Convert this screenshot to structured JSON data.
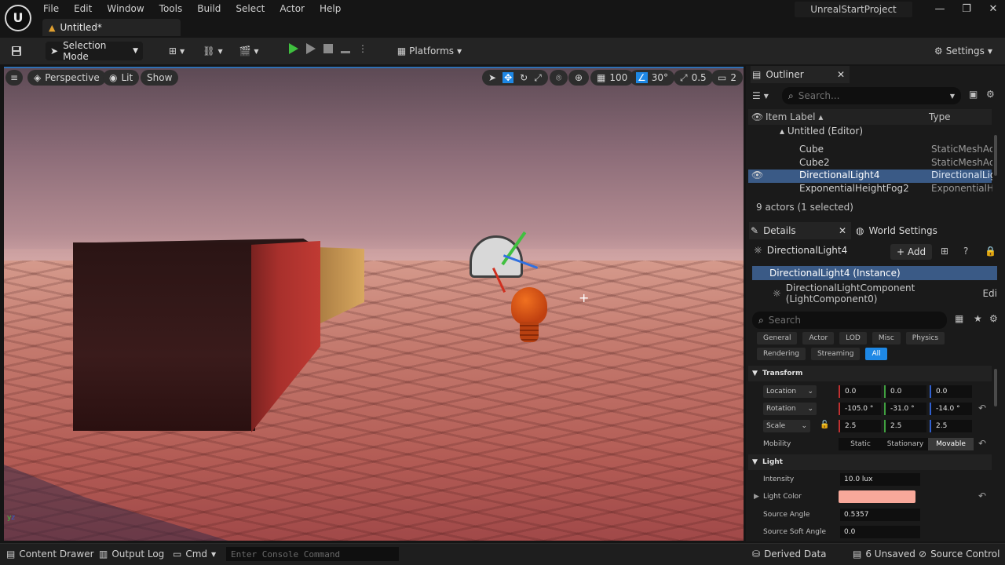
{
  "app": {
    "logo": "U",
    "project_title": "UnrealStartProject",
    "document_tab": "Untitled*",
    "menu": [
      "File",
      "Edit",
      "Window",
      "Tools",
      "Build",
      "Select",
      "Actor",
      "Help"
    ]
  },
  "toolbar": {
    "selection_mode": "Selection Mode",
    "platforms": "Platforms",
    "settings": "Settings"
  },
  "viewport": {
    "perspective": "Perspective",
    "lit": "Lit",
    "show": "Show",
    "grid_value": "100",
    "angle_value": "30°",
    "scale_value": "0.5",
    "camera_speed": "2"
  },
  "outliner": {
    "title": "Outliner",
    "search_placeholder": "Search...",
    "col_label": "Item Label ▴",
    "col_type": "Type",
    "rows": [
      {
        "label": "Untitled (Editor)",
        "type": ""
      },
      {
        "label": "Cube",
        "type": "StaticMeshActor"
      },
      {
        "label": "Cube2",
        "type": "StaticMeshActor"
      },
      {
        "label": "DirectionalLight4",
        "type": "DirectionalLight"
      },
      {
        "label": "ExponentialHeightFog2",
        "type": "ExponentialHeightFog"
      }
    ],
    "status": "9 actors (1 selected)"
  },
  "details": {
    "tab_details": "Details",
    "tab_world": "World Settings",
    "actor_name": "DirectionalLight4",
    "add_label": "+ Add",
    "instance": "DirectionalLight4 (Instance)",
    "component": "DirectionalLightComponent (LightComponent0)",
    "component_edit": "Edi",
    "search_placeholder": "Search",
    "categories_row1": [
      "General",
      "Actor",
      "LOD",
      "Misc",
      "Physics"
    ],
    "categories_row2": [
      "Rendering",
      "Streaming",
      "All"
    ],
    "transform": {
      "title": "Transform",
      "location_label": "Location",
      "location": [
        "0.0",
        "0.0",
        "0.0"
      ],
      "rotation_label": "Rotation",
      "rotation": [
        "-105.0 °",
        "-31.0 °",
        "-14.0 °"
      ],
      "scale_label": "Scale",
      "scale": [
        "2.5",
        "2.5",
        "2.5"
      ],
      "mobility_label": "Mobility",
      "mobility_options": [
        "Static",
        "Stationary",
        "Movable"
      ]
    },
    "light": {
      "title": "Light",
      "intensity_label": "Intensity",
      "intensity": "10.0 lux",
      "color_label": "Light Color",
      "color": "#f8a89a",
      "source_angle_label": "Source Angle",
      "source_angle": "0.5357",
      "source_soft_label": "Source Soft Angle",
      "source_soft": "0.0"
    }
  },
  "statusbar": {
    "content_drawer": "Content Drawer",
    "output_log": "Output Log",
    "cmd": "Cmd",
    "console_placeholder": "Enter Console Command",
    "derived_data": "Derived Data",
    "unsaved": "6 Unsaved",
    "source_control": "Source Control"
  }
}
